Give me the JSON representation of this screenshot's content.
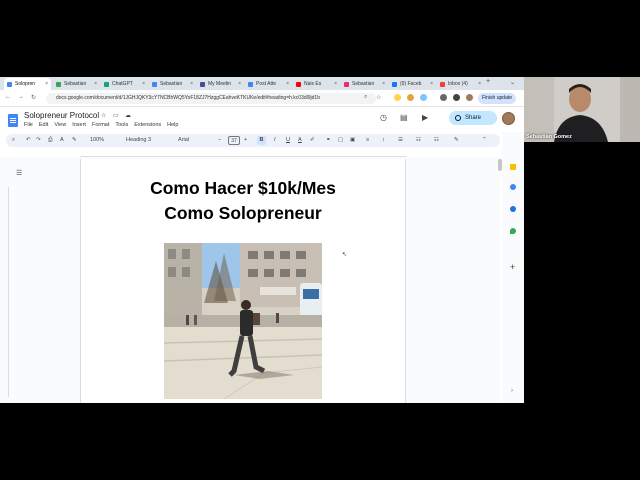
{
  "browser": {
    "tabs": [
      {
        "label": "Solopren",
        "active": true,
        "color": "#4285f4"
      },
      {
        "label": "Sebastian",
        "active": false,
        "color": "#34a853"
      },
      {
        "label": "ChatGPT",
        "active": false,
        "color": "#10a37f"
      },
      {
        "label": "Sebastian",
        "active": false,
        "color": "#4285f4"
      },
      {
        "label": "My Meetin",
        "active": false,
        "color": "#4b4b9b"
      },
      {
        "label": "Post Atte",
        "active": false,
        "color": "#4285f4"
      },
      {
        "label": "Nais Es",
        "active": false,
        "color": "#ff0000"
      },
      {
        "label": "Sebastian",
        "active": false,
        "color": "#e1306c"
      },
      {
        "label": "(9) Faceb",
        "active": false,
        "color": "#1877f2"
      },
      {
        "label": "Inbox (4)",
        "active": false,
        "color": "#ea4335"
      }
    ],
    "tab_close": "×",
    "new_tab": "+",
    "url": "docs.google.com/document/d/1JGHJQKY3cY7NCBhWQ5YoF18ZJ7HzggCEahveKTKUKe/edit#heading=h.kc03dl9jd1b",
    "finish_update": "Finish update"
  },
  "docs": {
    "title": "Solopreneur Protocol",
    "menu": [
      "File",
      "Edit",
      "View",
      "Insert",
      "Format",
      "Tools",
      "Extensions",
      "Help"
    ],
    "share_label": "Share",
    "toolbar": {
      "zoom": "100%",
      "style": "Heading 3",
      "font": "Arial",
      "font_size": "37",
      "bold": "B",
      "italic": "I",
      "underline": "U"
    }
  },
  "document": {
    "heading": "Como Hacer $10k/Mes\nComo Solopreneur"
  },
  "webcam": {
    "name": "Sebastian Gomez"
  }
}
